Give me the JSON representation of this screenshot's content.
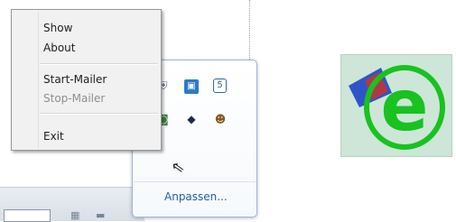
{
  "context_menu": {
    "items": [
      {
        "label": "Show",
        "enabled": true
      },
      {
        "label": "About",
        "enabled": true
      },
      {
        "label": "Start-Mailer",
        "enabled": true
      },
      {
        "label": "Stop-Mailer",
        "enabled": false
      },
      {
        "label": "Exit",
        "enabled": true
      }
    ]
  },
  "tray_overflow": {
    "customize_label": "Anpassen...",
    "icons": [
      "network-icon",
      "monitor-icon",
      "html5-icon",
      "security-icon",
      "diamond-icon",
      "messenger-icon"
    ]
  },
  "app_logo": {
    "letter": "e",
    "colors": {
      "letter": "#18c21f",
      "wedge": "#2e55c8",
      "accent": "#c8352d"
    }
  }
}
